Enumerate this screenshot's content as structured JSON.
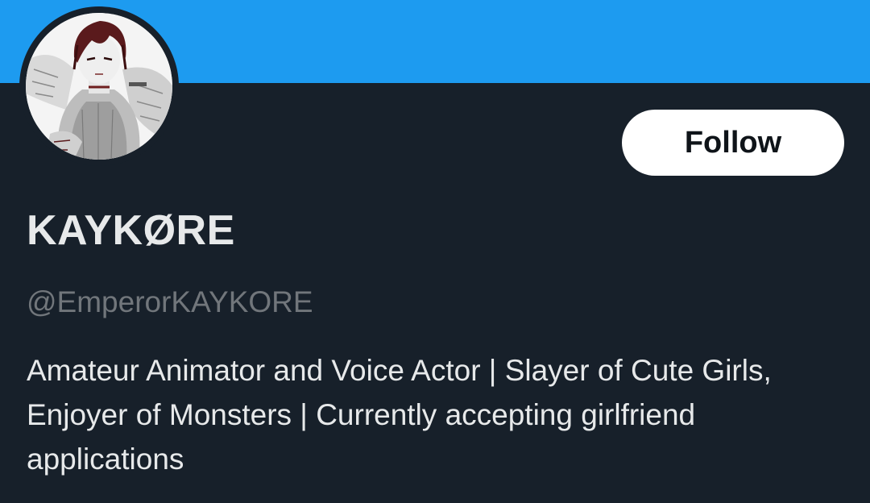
{
  "profile": {
    "display_name": "KAYKØRE",
    "handle": "@EmperorKAYKORE",
    "bio": "Amateur Animator and Voice Actor | Slayer of Cute Girls, Enjoyer of Monsters | Currently accepting girlfriend applications",
    "avatar_description_icon": "anime-character-avatar"
  },
  "actions": {
    "follow_label": "Follow"
  },
  "colors": {
    "banner": "#1d9bf0",
    "background": "#17202a",
    "text_primary": "#e7e9ea",
    "text_secondary": "#71767b",
    "button_bg": "#ffffff",
    "button_text": "#0f1419"
  }
}
